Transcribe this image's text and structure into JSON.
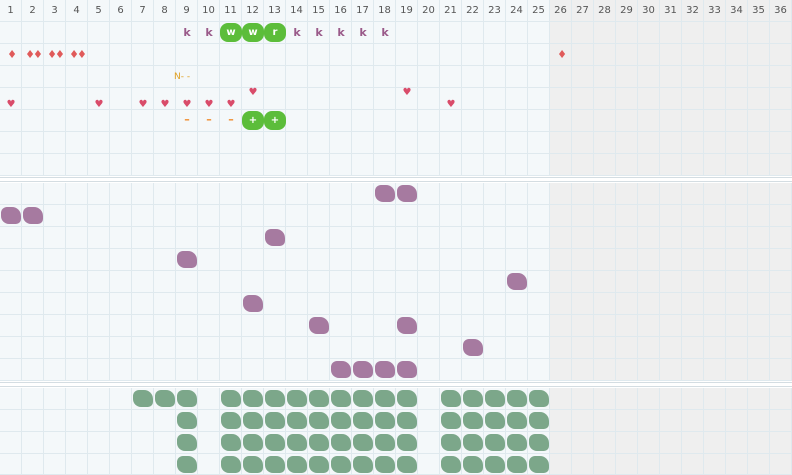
{
  "columns": [
    "1",
    "2",
    "3",
    "4",
    "5",
    "6",
    "7",
    "8",
    "9",
    "10",
    "11",
    "12",
    "13",
    "14",
    "15",
    "16",
    "17",
    "18",
    "19",
    "20",
    "21",
    "22",
    "23",
    "24",
    "25",
    "26",
    "27",
    "28",
    "29",
    "30",
    "31",
    "32",
    "33",
    "34",
    "35",
    "36"
  ],
  "active_columns": 25,
  "row_labels": {
    "k_label": "k",
    "w_label": "w",
    "r_label": "r",
    "plus_label": "+",
    "dash_label": "–",
    "note_label": "N- -"
  },
  "rows_top": {
    "k_marks": [
      9,
      10,
      14,
      15,
      16,
      17,
      18
    ],
    "pill_w": [
      11,
      12
    ],
    "pill_r": [
      13
    ],
    "drops": [
      {
        "col": 1,
        "count": 1
      },
      {
        "col": 2,
        "count": 2
      },
      {
        "col": 3,
        "count": 2
      },
      {
        "col": 4,
        "count": 2
      },
      {
        "col": 26,
        "count": 1
      }
    ],
    "note_col": 9,
    "hearts_row4": [
      1,
      5,
      7,
      8,
      9,
      10,
      11,
      19,
      21
    ],
    "heart_row3": [
      12
    ],
    "dashes": [
      9,
      10,
      11
    ],
    "plus_pills": [
      12,
      13
    ]
  },
  "purple_marks": [
    {
      "col": 18,
      "row": 1
    },
    {
      "col": 19,
      "row": 1
    },
    {
      "col": 1,
      "row": 2
    },
    {
      "col": 2,
      "row": 2
    },
    {
      "col": 13,
      "row": 3
    },
    {
      "col": 9,
      "row": 4
    },
    {
      "col": 24,
      "row": 5
    },
    {
      "col": 12,
      "row": 6
    },
    {
      "col": 15,
      "row": 7
    },
    {
      "col": 19,
      "row": 7
    },
    {
      "col": 22,
      "row": 8
    },
    {
      "col": 16,
      "row": 9
    },
    {
      "col": 17,
      "row": 9
    },
    {
      "col": 18,
      "row": 9
    },
    {
      "col": 19,
      "row": 9
    }
  ],
  "green_rows": [
    [
      7,
      8,
      9,
      11,
      12,
      13,
      14,
      15,
      16,
      17,
      18,
      19,
      21,
      22,
      23,
      24,
      25
    ],
    [
      9,
      11,
      12,
      13,
      14,
      15,
      16,
      17,
      18,
      19,
      21,
      22,
      23,
      24,
      25
    ],
    [
      9,
      11,
      12,
      13,
      14,
      15,
      16,
      17,
      18,
      19,
      21,
      22,
      23,
      24,
      25
    ],
    [
      9,
      11,
      12,
      13,
      14,
      15,
      16,
      17,
      18,
      19,
      21,
      22,
      23,
      24,
      25
    ]
  ],
  "colors": {
    "purple": "#a67aa0",
    "green": "#7ca78a",
    "pill": "#5cbd3a",
    "heart": "#d94c6a"
  }
}
